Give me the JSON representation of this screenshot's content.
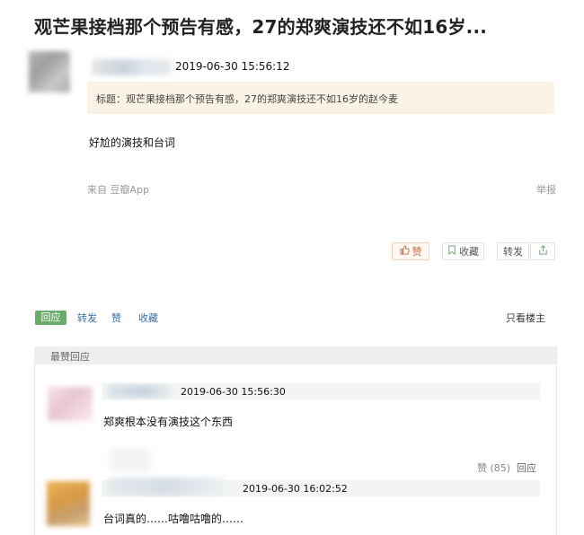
{
  "post": {
    "title": "观芒果接档那个预告有感，27的郑爽演技还不如16岁...",
    "time": "2019-06-30 15:56:12",
    "notice": "标题：观芒果接档那个预告有感，27的郑爽演技还不如16岁的赵今麦",
    "body": "好尬的演技和台词",
    "from": "来自 豆瓣App",
    "report": "举报",
    "actions": {
      "like": "赞",
      "favorite": "收藏",
      "share": "转发"
    }
  },
  "tabs": {
    "reply": "回应",
    "share": "转发",
    "like": "赞",
    "favorite": "收藏",
    "only_op": "只看楼主"
  },
  "comments_section": {
    "heading": "最赞回应",
    "comments": [
      {
        "time": "2019-06-30 15:56:30",
        "text": "郑爽根本没有演技这个东西",
        "like_label": "赞 (85)",
        "reply_label": "回应"
      },
      {
        "time": "2019-06-30 16:02:52",
        "text": "台词真的……咕噜咕噜的……"
      }
    ]
  },
  "icons": {
    "like": "thumbs-up-icon",
    "favorite": "bookmark-icon",
    "export": "share-out-icon"
  }
}
